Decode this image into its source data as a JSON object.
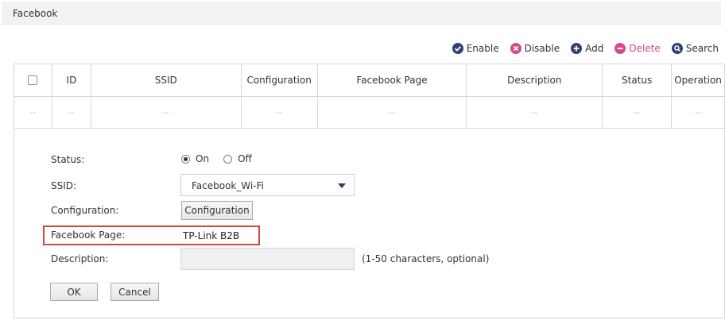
{
  "header": {
    "title": "Facebook"
  },
  "toolbar": {
    "enable_label": "Enable",
    "disable_label": "Disable",
    "add_label": "Add",
    "delete_label": "Delete",
    "search_label": "Search",
    "colors": {
      "enable": "#2d4373",
      "disable": "#d64a88",
      "add": "#2d4373",
      "delete": "#d64a88",
      "search": "#2d4373"
    }
  },
  "table": {
    "columns": [
      "ID",
      "SSID",
      "Configuration",
      "Facebook Page",
      "Description",
      "Status",
      "Operation"
    ],
    "empty_row": [
      "--",
      "--",
      "--",
      "--",
      "--",
      "--",
      "--",
      "--"
    ]
  },
  "form": {
    "status_label": "Status:",
    "status_on": "On",
    "status_off": "Off",
    "status_value": "On",
    "ssid_label": "SSID:",
    "ssid_value": "Facebook_Wi-Fi",
    "configuration_label": "Configuration:",
    "configuration_button": "Configuration",
    "facebook_page_label": "Facebook Page:",
    "facebook_page_value": "TP-Link B2B",
    "description_label": "Description:",
    "description_value": "",
    "description_hint": "(1-50 characters, optional)",
    "ok_label": "OK",
    "cancel_label": "Cancel",
    "highlight_color": "#d0473b"
  }
}
